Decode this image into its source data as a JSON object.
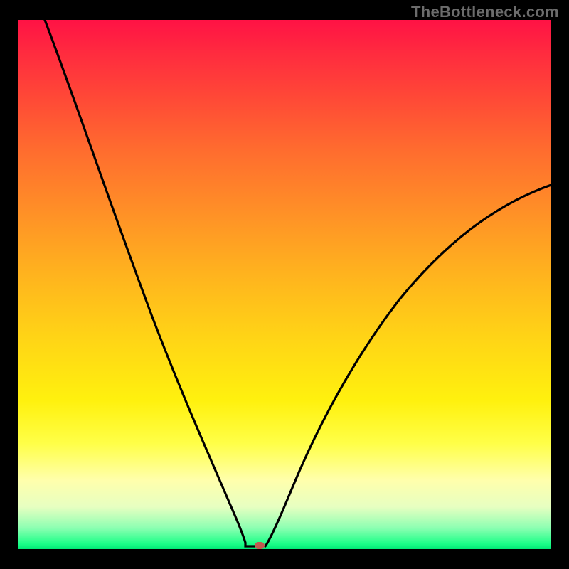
{
  "watermark": "TheBottleneck.com",
  "chart_data": {
    "type": "line",
    "title": "",
    "xlabel": "",
    "ylabel": "",
    "xlim": [
      0,
      100
    ],
    "ylim": [
      0,
      100
    ],
    "legend": false,
    "grid": false,
    "background_gradient": [
      "#ff1245",
      "#ff8f27",
      "#ffff47",
      "#00e876"
    ],
    "marker": {
      "x": 44,
      "y": 1,
      "color": "#c05a50",
      "shape": "rounded-rect"
    },
    "series": [
      {
        "name": "left-branch",
        "x": [
          0,
          3,
          6,
          9,
          12,
          15,
          18,
          21,
          24,
          27,
          30,
          33,
          36,
          38,
          40,
          41,
          42,
          43,
          44,
          45
        ],
        "values": [
          100,
          93,
          86,
          79,
          72,
          65,
          58,
          51,
          44,
          37,
          30,
          23,
          16,
          11,
          6,
          4,
          2.5,
          1.2,
          0.5,
          0.3
        ]
      },
      {
        "name": "right-branch",
        "x": [
          46,
          48,
          50,
          53,
          56,
          60,
          65,
          70,
          75,
          80,
          85,
          90,
          95,
          100
        ],
        "values": [
          0.6,
          2,
          5,
          10,
          16,
          23,
          31,
          39,
          46,
          52,
          57,
          61,
          64,
          66
        ]
      }
    ],
    "annotations": []
  }
}
